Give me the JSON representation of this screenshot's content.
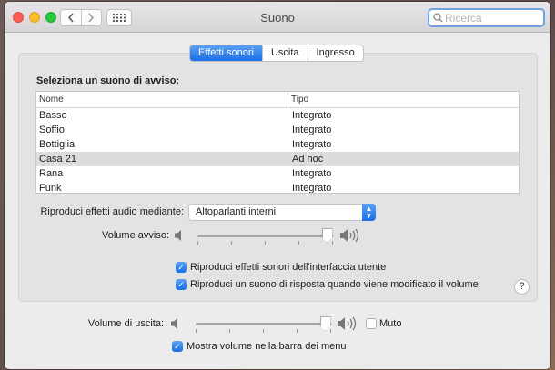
{
  "window": {
    "title": "Suono"
  },
  "search": {
    "placeholder": "Ricerca"
  },
  "tabs": [
    {
      "label": "Effetti sonori",
      "active": true
    },
    {
      "label": "Uscita",
      "active": false
    },
    {
      "label": "Ingresso",
      "active": false
    }
  ],
  "alert": {
    "title": "Seleziona un suono di avviso:",
    "columns": [
      "Nome",
      "Tipo"
    ],
    "rows": [
      {
        "name": "Basso",
        "type": "Integrato"
      },
      {
        "name": "Soffio",
        "type": "Integrato"
      },
      {
        "name": "Bottiglia",
        "type": "Integrato"
      },
      {
        "name": "Casa 21",
        "type": "Ad hoc",
        "selected": true
      },
      {
        "name": "Rana",
        "type": "Integrato"
      },
      {
        "name": "Funk",
        "type": "Integrato"
      }
    ]
  },
  "playback": {
    "label": "Riproduci effetti audio mediante:",
    "selected": "Altoparlanti interni"
  },
  "alert_volume": {
    "label": "Volume avviso:",
    "level": 0.95
  },
  "checkboxes": {
    "ui_sounds": {
      "label": "Riproduci effetti sonori dell'interfaccia utente",
      "checked": true
    },
    "feedback": {
      "label": "Riproduci un suono di risposta quando viene modificato il volume",
      "checked": true
    },
    "menu_bar": {
      "label": "Mostra volume nella barra dei menu",
      "checked": true
    }
  },
  "output_volume": {
    "label": "Volume di uscita:",
    "level": 0.95
  },
  "mute": {
    "label": "Muto",
    "checked": false
  },
  "help": {
    "label": "?"
  },
  "icons": {
    "back": "chevron-left-icon",
    "forward": "chevron-right-icon",
    "grid": "grid-icon",
    "search": "search-icon",
    "speaker_low": "speaker-low-icon",
    "speaker_high": "speaker-high-icon",
    "checkmark": "checkmark-icon"
  },
  "colors": {
    "accent": "#1a6fe8",
    "search_focus": "#6fa3e0"
  }
}
